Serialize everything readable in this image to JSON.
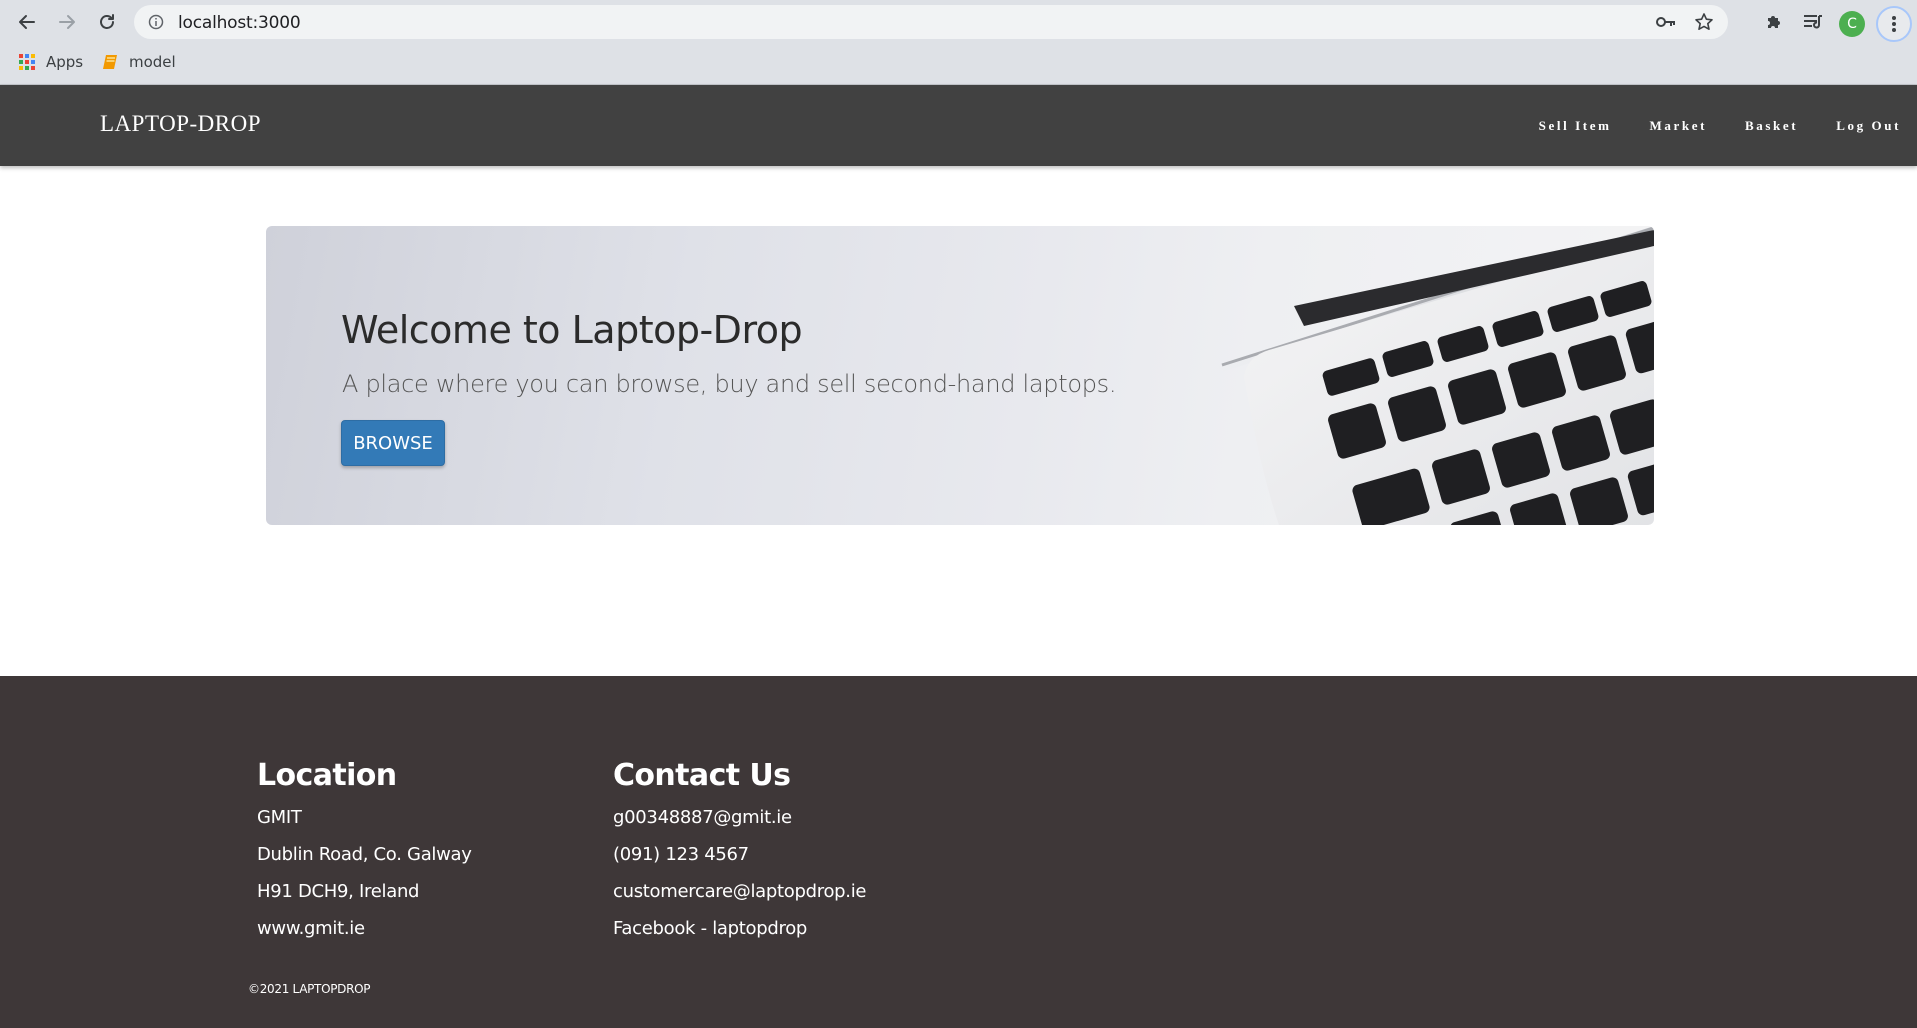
{
  "browser": {
    "url": "localhost:3000",
    "profile_initial": "C",
    "bookmarks": [
      {
        "label": "Apps",
        "icon": "apps-grid-icon"
      },
      {
        "label": "model",
        "icon": "bookmark-folder-icon"
      }
    ]
  },
  "navbar": {
    "brand": "LAPTOP-DROP",
    "links": [
      "Sell Item",
      "Market",
      "Basket",
      "Log Out"
    ]
  },
  "hero": {
    "title": "Welcome to Laptop-Drop",
    "subtitle": "A place where you can browse, buy and sell second-hand laptops.",
    "button": "BROWSE",
    "image": "laptop-keyboard-photo"
  },
  "footer": {
    "location": {
      "heading": "Location",
      "lines": [
        "GMIT",
        "Dublin Road, Co. Galway",
        "H91 DCH9, Ireland",
        "www.gmit.ie"
      ]
    },
    "contact": {
      "heading": "Contact Us",
      "lines": [
        "g00348887@gmit.ie",
        "(091) 123 4567",
        "customercare@laptopdrop.ie",
        "Facebook - laptopdrop"
      ]
    },
    "copyright": "©2021 LAPTOPDROP"
  },
  "colors": {
    "navbar_bg": "#414141",
    "footer_bg": "#3e3738",
    "button_primary": "#337ab7"
  }
}
